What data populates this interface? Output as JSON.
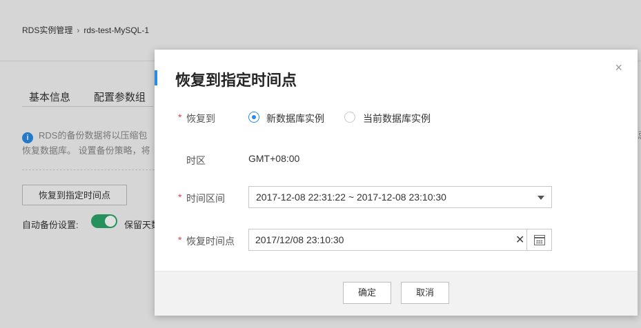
{
  "background": {
    "breadcrumb": {
      "root": "RDS实例管理",
      "separator": "›",
      "current": "rds-test-MySQL-1"
    },
    "tabs": [
      "基本信息",
      "配置参数组"
    ],
    "info_text_1": "RDS的备份数据将以压缩包",
    "info_text_2": "恢复数据库。 设置备份策略，将",
    "info_icon": "i",
    "right_edge_text": "忌",
    "restore_button": "恢复到指定时间点",
    "auto_backup_label": "自动备份设置:",
    "retain_label": "保留天数"
  },
  "modal": {
    "title": "恢复到指定时间点",
    "close_glyph": "×",
    "restore_to": {
      "label": "恢复到",
      "options": [
        {
          "label": "新数据库实例",
          "checked": true
        },
        {
          "label": "当前数据库实例",
          "checked": false
        }
      ]
    },
    "timezone": {
      "label": "时区",
      "value": "GMT+08:00"
    },
    "time_range": {
      "label": "时间区间",
      "value": "2017-12-08 22:31:22 ~ 2017-12-08 23:10:30"
    },
    "restore_point": {
      "label": "恢复时间点",
      "value": "2017/12/08 23:10:30",
      "clear_glyph": "✕"
    },
    "required_mark": "*",
    "confirm_button": "确定",
    "cancel_button": "取消"
  },
  "colors": {
    "accent": "#2a8ae6",
    "required": "#e0443f",
    "toggle_on": "#2da66b"
  },
  "icons": [
    "info-icon",
    "close-icon",
    "clear-icon",
    "calendar-icon",
    "chevron-down-icon"
  ]
}
